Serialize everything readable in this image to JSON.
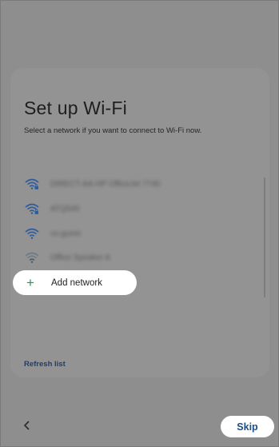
{
  "setup": {
    "title": "Set up Wi-Fi",
    "subtitle": "Select a network if you want to connect to Wi-Fi now.",
    "networks": [
      {
        "name": "DIRECT-AA-HP OfficeJet 7740",
        "icon": "wifi-lock-icon"
      },
      {
        "name": "ATQ540",
        "icon": "wifi-lock-icon"
      },
      {
        "name": "vs-guest",
        "icon": "wifi-icon"
      },
      {
        "name": "Office Speaker A",
        "icon": "wifi-weak-icon"
      }
    ],
    "add_network": {
      "icon": "plus-icon",
      "label": "Add network"
    },
    "refresh_label": "Refresh list"
  },
  "footer": {
    "back_icon": "chevron-left-icon",
    "skip_label": "Skip"
  },
  "colors": {
    "overlay": "#8e8e8e",
    "card": "#939393",
    "accent_green": "#1e9a56",
    "link_blue": "#1c3f6e",
    "wifi_icon": "#2d5a9c"
  }
}
